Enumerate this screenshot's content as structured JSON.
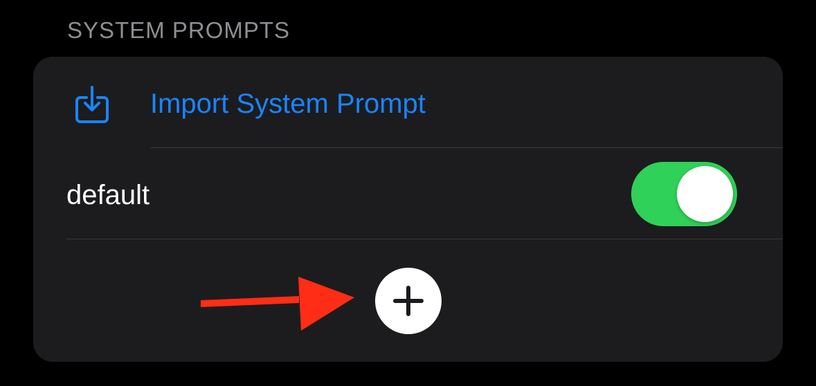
{
  "section": {
    "title": "SYSTEM PROMPTS"
  },
  "import_row": {
    "label": "Import System Prompt",
    "icon": "import-tray-icon"
  },
  "prompts": [
    {
      "label": "default",
      "enabled": true
    }
  ],
  "add_button": {
    "icon": "plus-icon"
  },
  "annotation": {
    "icon": "red-arrow-pointer"
  },
  "colors": {
    "background": "#000000",
    "card": "#1c1c1e",
    "accent": "#1a84ff",
    "toggle_on": "#30d158",
    "annotation": "#ff2d16",
    "secondary_text": "#8e8e93"
  }
}
